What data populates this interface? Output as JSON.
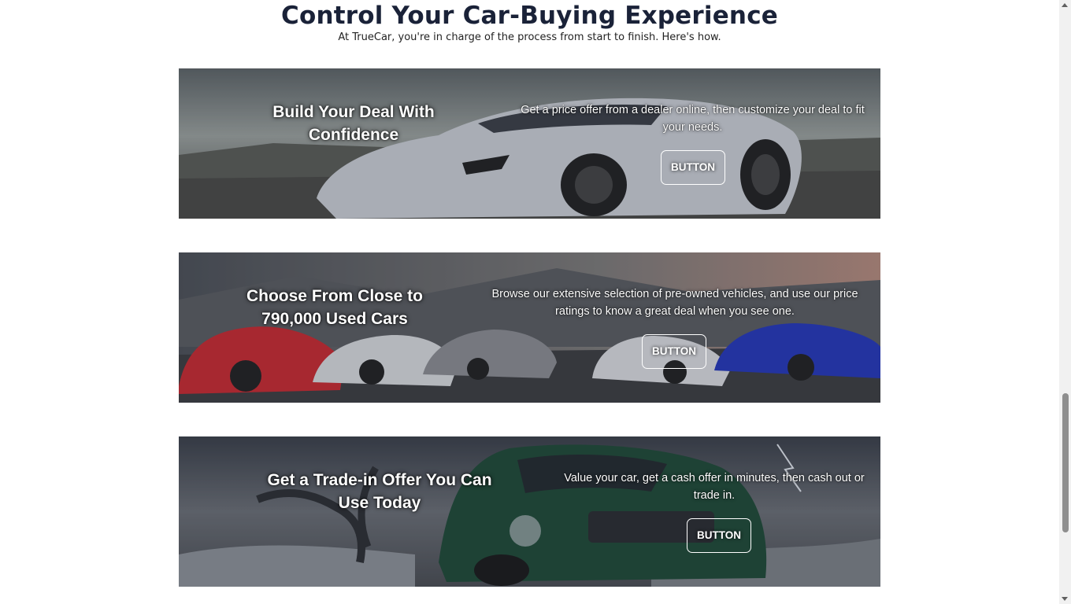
{
  "section": {
    "title": "Control Your Car-Buying Experience",
    "subtitle": "At TrueCar, you're in charge of the process from start to finish. Here's how."
  },
  "banners": [
    {
      "title": "Build Your Deal With Confidence",
      "text": "Get a price offer from a dealer online, then customize your deal to fit your needs.",
      "button": "BUTTON"
    },
    {
      "title": "Choose From Close to 790,000 Used Cars",
      "text": "Browse our extensive selection of pre-owned vehicles, and use our price ratings to know a great deal when you see one.",
      "button": "BUTTON"
    },
    {
      "title": "Get a Trade-in Offer You Can Use Today",
      "text": "Value your car, get a cash offer in minutes, then cash out or trade in.",
      "button": "BUTTON"
    }
  ],
  "colors": {
    "heading": "#1a2238",
    "button_border": "#ffffff"
  }
}
